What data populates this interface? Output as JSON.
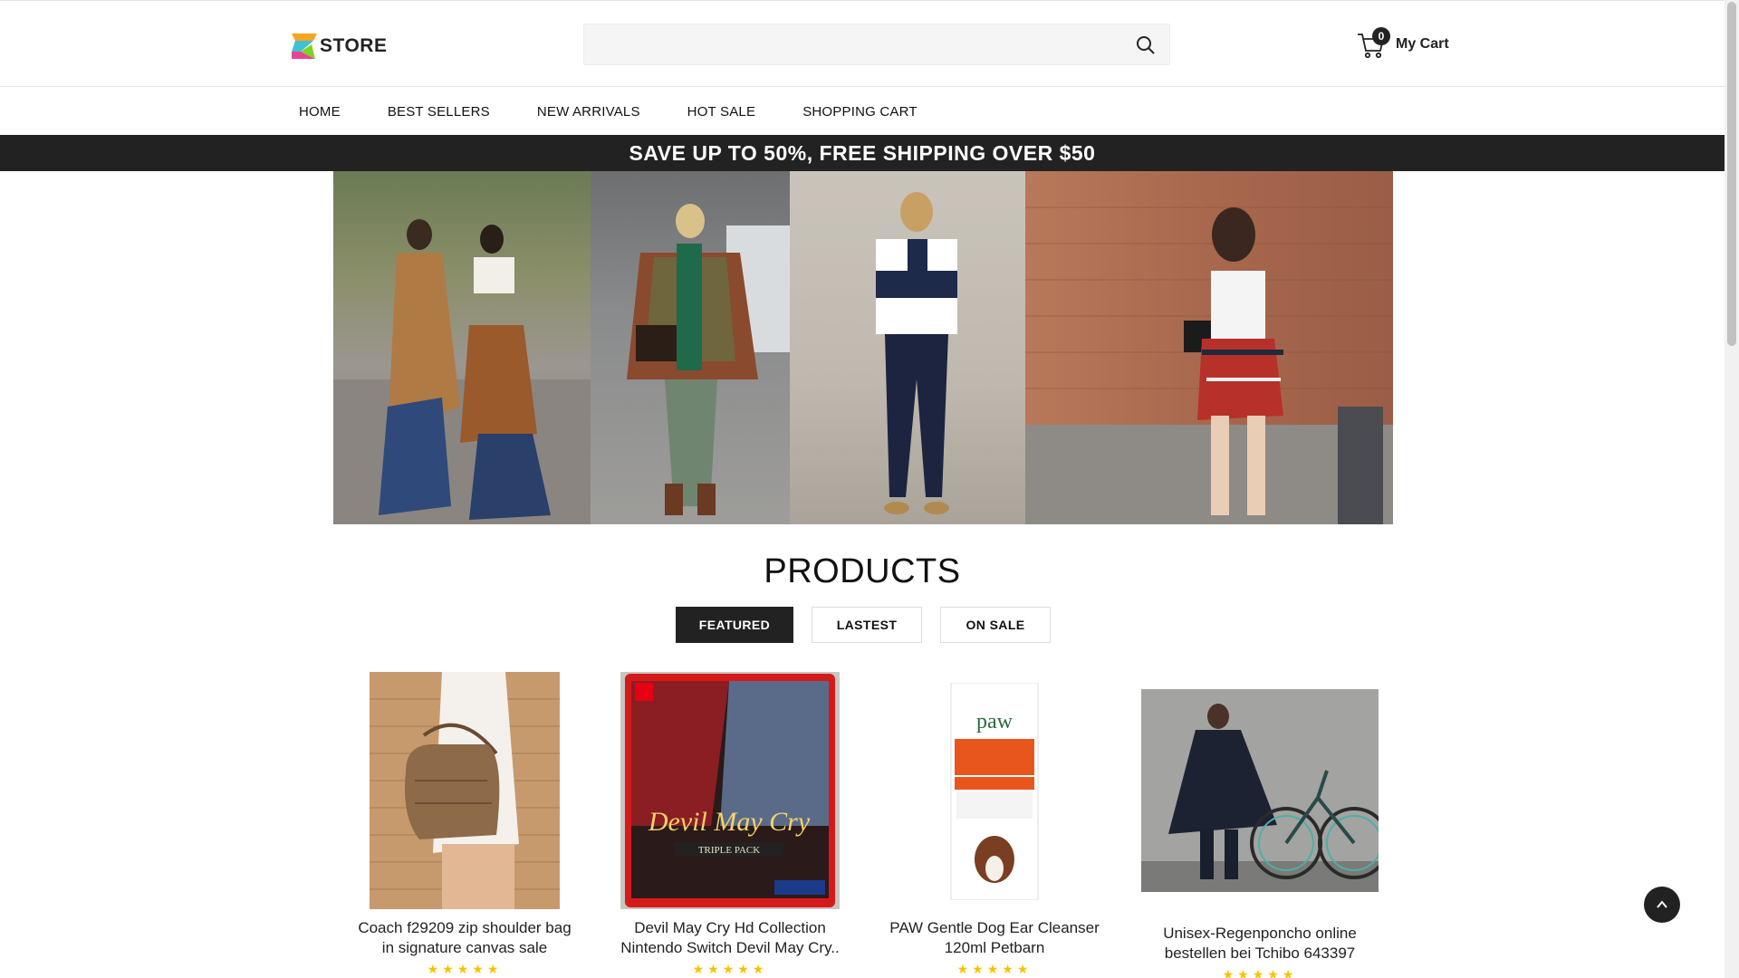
{
  "header": {
    "logo_text": "STORE",
    "search_placeholder": "",
    "cart_count": "0",
    "cart_label": "My Cart"
  },
  "nav": {
    "items": [
      {
        "label": "HOME"
      },
      {
        "label": "BEST SELLERS"
      },
      {
        "label": "NEW ARRIVALS"
      },
      {
        "label": "HOT SALE"
      },
      {
        "label": "SHOPPING CART"
      }
    ]
  },
  "promo": {
    "text": "SAVE UP TO 50%, FREE SHIPPING OVER $50"
  },
  "products_section": {
    "title": "PRODUCTS",
    "tabs": [
      {
        "label": "FEATURED",
        "active": true
      },
      {
        "label": "LASTEST",
        "active": false
      },
      {
        "label": "ON SALE",
        "active": false
      }
    ],
    "items": [
      {
        "title_line1": "Coach f29209 zip shoulder bag",
        "title_line2": "in signature canvas sale",
        "stars": "★★★★★"
      },
      {
        "title_line1": "Devil May Cry Hd Collection",
        "title_line2": "Nintendo Switch Devil May Cry..",
        "stars": "★★★★★"
      },
      {
        "title_line1": "PAW Gentle Dog Ear Cleanser",
        "title_line2": "120ml Petbarn",
        "stars": "★★★★★"
      },
      {
        "title_line1": "Unisex-Regenponcho online",
        "title_line2": "bestellen bei Tchibo 643397",
        "stars": "★★★★★"
      }
    ]
  },
  "colors": {
    "dark": "#222222",
    "star": "#f4c400",
    "search_bg": "#f5f5f5"
  },
  "icons": {
    "search": "search-icon",
    "cart": "cart-icon",
    "back_to_top": "chevron-up-icon"
  }
}
